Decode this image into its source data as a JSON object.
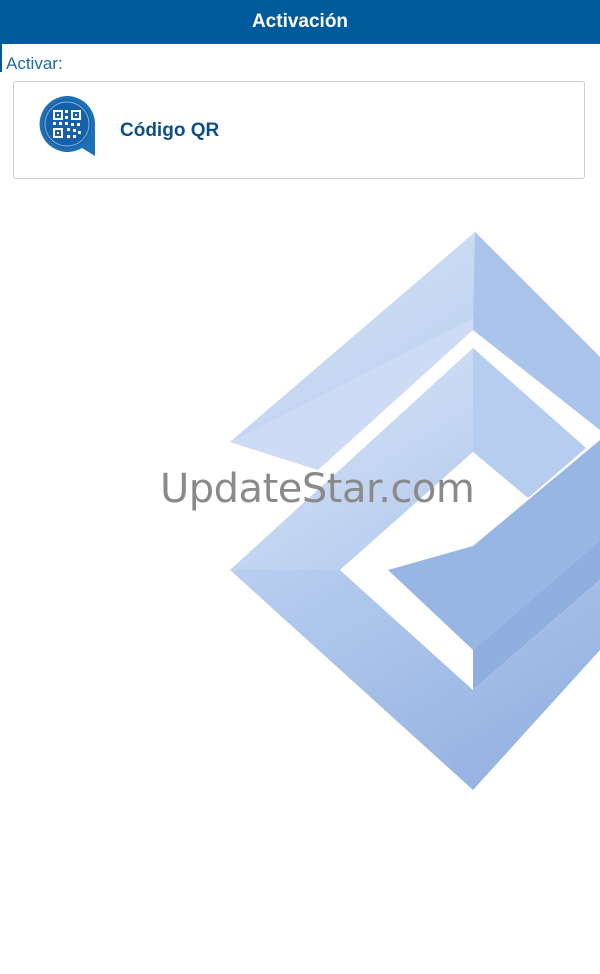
{
  "header": {
    "title": "Activación"
  },
  "section": {
    "label": "Activar:"
  },
  "options": [
    {
      "label": "Código QR",
      "icon": "qr-code-icon"
    }
  ],
  "watermark": {
    "text": "UpdateStar.com",
    "icon": "updatestar-logo-icon"
  },
  "colors": {
    "header_bg": "#005a9c",
    "accent": "#1f6aa8",
    "option_text": "#0e4f86",
    "logo": "#a9c3ea"
  }
}
